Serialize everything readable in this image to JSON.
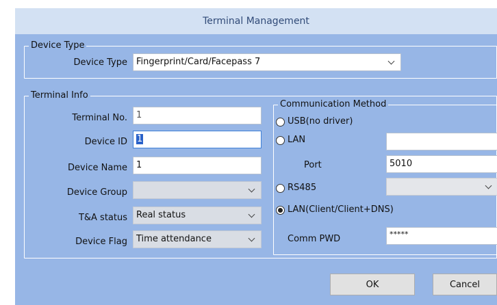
{
  "window": {
    "title": "Terminal Management"
  },
  "device_type_group": {
    "title": "Device Type",
    "label": "Device Type",
    "value": "Fingerprint/Card/Facepass 7"
  },
  "terminal_info": {
    "title": "Terminal Info",
    "terminal_no": {
      "label": "Terminal No.",
      "value": "1"
    },
    "device_id": {
      "label": "Device ID",
      "value": "1"
    },
    "device_name": {
      "label": "Device Name",
      "value": "1"
    },
    "device_group": {
      "label": "Device Group",
      "value": ""
    },
    "ta_status": {
      "label": "T&A status",
      "value": "Real status"
    },
    "device_flag": {
      "label": "Device Flag",
      "value": "Time attendance"
    }
  },
  "communication": {
    "title": "Communication Method",
    "usb_label": "USB(no driver)",
    "lan_label": "LAN",
    "lan_ip_value": "",
    "port_label": "Port",
    "port_value": "5010",
    "rs485_label": "RS485",
    "rs485_value": "",
    "lan_client_label": "LAN(Client/Client+DNS)",
    "selected": "LAN(Client/Client+DNS)",
    "comm_pwd_label": "Comm PWD",
    "comm_pwd_value": "*****"
  },
  "buttons": {
    "ok": "OK",
    "cancel": "Cancel"
  },
  "colors": {
    "title_bar": "#d3e1f3",
    "client_area": "#97b6e6",
    "selection": "#2a62c9"
  }
}
